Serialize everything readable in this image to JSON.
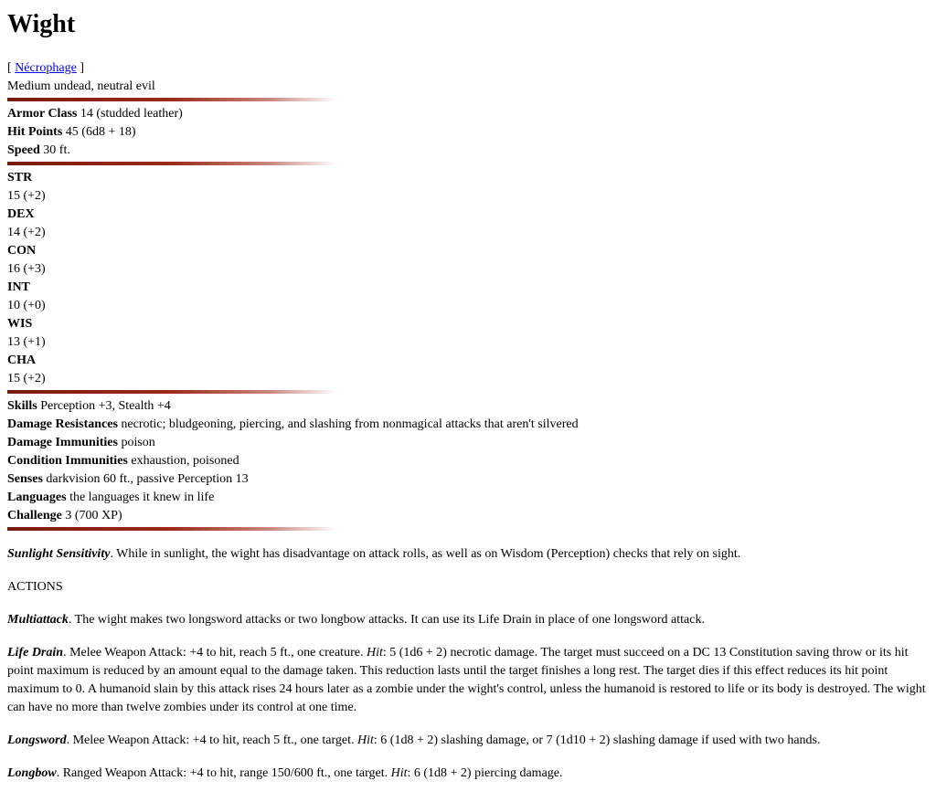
{
  "title": "Wight",
  "tag": {
    "open": "[ ",
    "link": "Nécrophage",
    "close": " ]"
  },
  "type_line": "Medium undead, neutral evil",
  "defense": [
    {
      "label": "Armor Class",
      "value": "14 (studded leather)"
    },
    {
      "label": "Hit Points",
      "value": "45 (6d8 + 18)"
    },
    {
      "label": "Speed",
      "value": "30 ft."
    }
  ],
  "abilities": [
    {
      "name": "STR",
      "score": "15 (+2)"
    },
    {
      "name": "DEX",
      "score": "14 (+2)"
    },
    {
      "name": "CON",
      "score": "16 (+3)"
    },
    {
      "name": "INT",
      "score": "10 (+0)"
    },
    {
      "name": "WIS",
      "score": "13 (+1)"
    },
    {
      "name": "CHA",
      "score": "15 (+2)"
    }
  ],
  "traits": [
    {
      "label": "Skills",
      "value": "Perception +3, Stealth +4"
    },
    {
      "label": "Damage Resistances",
      "value": "necrotic; bludgeoning, piercing, and slashing from nonmagical attacks that aren't silvered"
    },
    {
      "label": "Damage Immunities",
      "value": "poison"
    },
    {
      "label": "Condition Immunities",
      "value": "exhaustion, poisoned"
    },
    {
      "label": "Senses",
      "value": "darkvision 60 ft., passive Perception 13"
    },
    {
      "label": "Languages",
      "value": "the languages it knew in life"
    },
    {
      "label": "Challenge",
      "value": "3 (700 XP)"
    }
  ],
  "special": {
    "name": "Sunlight Sensitivity",
    "text": ". While in sunlight, the wight has disadvantage on attack rolls, as well as on Wisdom (Perception) checks that rely on sight."
  },
  "actions_heading": "ACTIONS",
  "actions": [
    {
      "name": "Multiattack",
      "pre": ". The wight makes two longsword attacks or two longbow attacks. It can use its Life Drain in place of one longsword attack.",
      "hit": "",
      "post": ""
    },
    {
      "name": "Life Drain",
      "pre": ". Melee Weapon Attack: +4 to hit, reach 5 ft., one creature. ",
      "hit": "Hit",
      "post": ": 5 (1d6 + 2) necrotic damage. The target must succeed on a DC 13 Constitution saving throw or its hit point maximum is reduced by an amount equal to the damage taken. This reduction lasts until the target finishes a long rest. The target dies if this effect reduces its hit point maximum to 0. A humanoid slain by this attack rises 24 hours later as a zombie under the wight's control, unless the humanoid is restored to life or its body is destroyed. The wight can have no more than twelve zombies under its control at one time."
    },
    {
      "name": "Longsword",
      "pre": ". Melee Weapon Attack: +4 to hit, reach 5 ft., one target. ",
      "hit": "Hit",
      "post": ": 6 (1d8 + 2) slashing damage, or 7 (1d10 + 2) slashing damage if used with two hands."
    },
    {
      "name": "Longbow",
      "pre": ". Ranged Weapon Attack: +4 to hit, range 150/600 ft., one target. ",
      "hit": "Hit",
      "post": ": 6 (1d8 + 2) piercing damage."
    }
  ],
  "colors": {
    "rule": "#9c2a17",
    "link": "#0000ee"
  }
}
